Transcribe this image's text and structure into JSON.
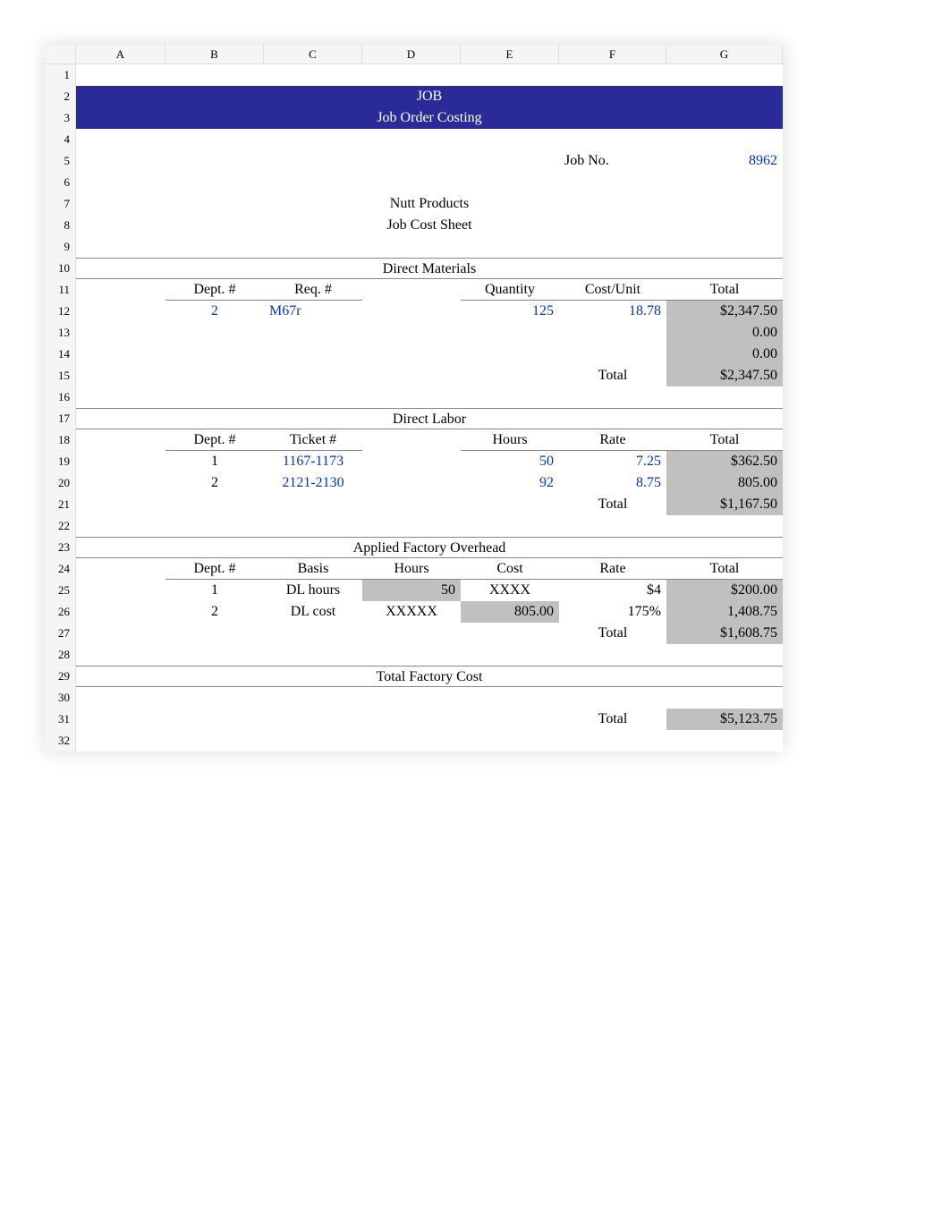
{
  "columns": [
    "A",
    "B",
    "C",
    "D",
    "E",
    "F",
    "G"
  ],
  "rows": [
    "1",
    "2",
    "3",
    "4",
    "5",
    "6",
    "7",
    "8",
    "9",
    "10",
    "11",
    "12",
    "13",
    "14",
    "15",
    "16",
    "17",
    "18",
    "19",
    "20",
    "21",
    "22",
    "23",
    "24",
    "25",
    "26",
    "27",
    "28",
    "29",
    "30",
    "31",
    "32"
  ],
  "banner": {
    "title": "JOB",
    "subtitle": "Job Order Costing"
  },
  "jobno": {
    "label": "Job No.",
    "value": "8962"
  },
  "company": "Nutt Products",
  "sheet_title": "Job Cost Sheet",
  "sections": {
    "dm": {
      "title": "Direct Materials",
      "headers": {
        "dept": "Dept. #",
        "req": "Req. #",
        "qty": "Quantity",
        "costunit": "Cost/Unit",
        "total": "Total"
      },
      "rows": [
        {
          "dept": "2",
          "req": "M67r",
          "qty": "125",
          "costunit": "18.78",
          "total": "$2,347.50"
        },
        {
          "dept": "",
          "req": "",
          "qty": "",
          "costunit": "",
          "total": "0.00"
        },
        {
          "dept": "",
          "req": "",
          "qty": "",
          "costunit": "",
          "total": "0.00"
        }
      ],
      "total_label": "Total",
      "total_value": "$2,347.50"
    },
    "dl": {
      "title": "Direct Labor",
      "headers": {
        "dept": "Dept. #",
        "ticket": "Ticket #",
        "hours": "Hours",
        "rate": "Rate",
        "total": "Total"
      },
      "rows": [
        {
          "dept": "1",
          "ticket": "1167-1173",
          "hours": "50",
          "rate": "7.25",
          "total": "$362.50"
        },
        {
          "dept": "2",
          "ticket": "2121-2130",
          "hours": "92",
          "rate": "8.75",
          "total": "805.00"
        }
      ],
      "total_label": "Total",
      "total_value": "$1,167.50"
    },
    "afo": {
      "title": "Applied Factory Overhead",
      "headers": {
        "dept": "Dept. #",
        "basis": "Basis",
        "hours": "Hours",
        "cost": "Cost",
        "rate": "Rate",
        "total": "Total"
      },
      "rows": [
        {
          "dept": "1",
          "basis": "DL hours",
          "hours": "50",
          "cost": "XXXX",
          "rate": "$4",
          "total": "$200.00"
        },
        {
          "dept": "2",
          "basis": "DL cost",
          "hours": "XXXXX",
          "cost": "805.00",
          "rate": "175%",
          "total": "1,408.75"
        }
      ],
      "total_label": "Total",
      "total_value": "$1,608.75"
    },
    "tfc": {
      "title": "Total Factory Cost",
      "total_label": "Total",
      "total_value": "$5,123.75"
    }
  }
}
